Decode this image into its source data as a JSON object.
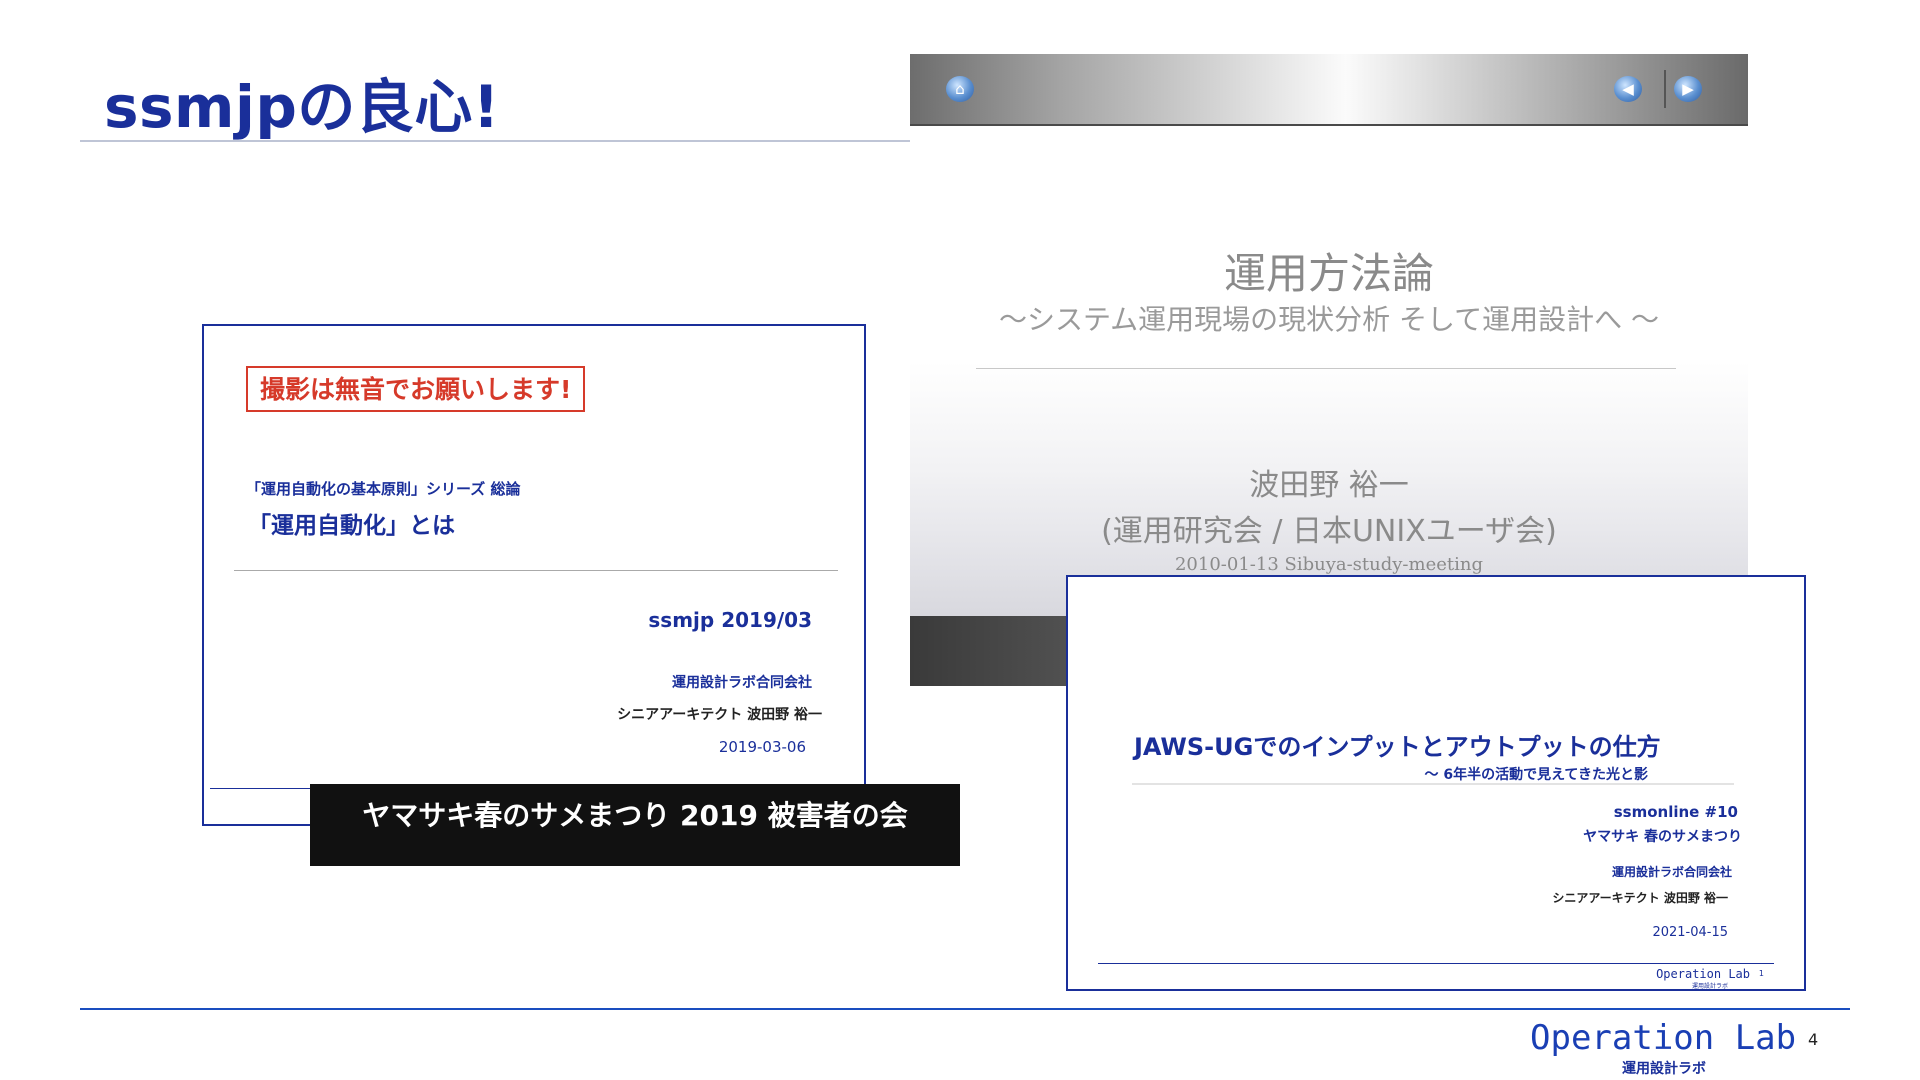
{
  "slide": {
    "title": "ssmjpの良心!",
    "page_number": "4"
  },
  "keynote_slide": {
    "title": "運用方法論",
    "subtitle": "〜システム運用現場の現状分析 そして運用設計へ 〜",
    "author": "波田野 裕一",
    "org": "(運用研究会 / 日本UNIXユーザ会)",
    "date": "2010-01-13 Sibuya-study-meeting",
    "toolbar_icons": [
      "home-icon",
      "back-icon",
      "forward-icon"
    ]
  },
  "left_slide": {
    "notice": "撮影は無音でお願いします!",
    "series": "「運用自動化の基本原則」シリーズ 総論",
    "title": "「運用自動化」とは",
    "event": "ssmjp 2019/03",
    "company": "運用設計ラボ合同会社",
    "person": "シニアアーキテクト 波田野 裕一",
    "date": "2019-03-06"
  },
  "banner": {
    "text": "ヤマサキ春のサメまつり 2019 被害者の会"
  },
  "right_slide": {
    "title": "JAWS-UGでのインプットとアウトプットの仕方",
    "subtitle": "〜 6年半の活動で見えてきた光と影",
    "event": "ssmonline #10",
    "event_sub": "ヤマサキ 春のサメまつり",
    "company": "運用設計ラボ合同会社",
    "person": "シニアアーキテクト 波田野 裕一",
    "date": "2021-04-15",
    "footer_lab": "Operation Lab",
    "footer_lab_jp": "運用設計ラボ",
    "page": "1"
  },
  "footer": {
    "lab": "Operation Lab",
    "lab_jp": "運用設計ラボ"
  },
  "colors": {
    "brand_blue": "#1a2f9a",
    "notice_red": "#d63a2a"
  }
}
